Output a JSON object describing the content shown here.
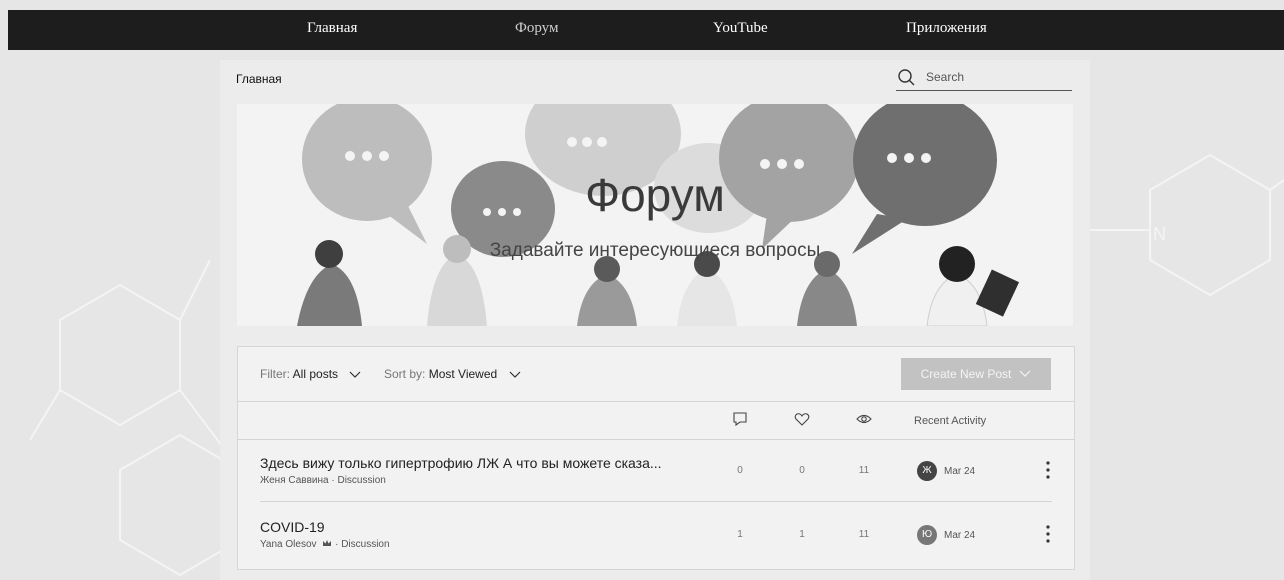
{
  "nav": {
    "items": [
      "Главная",
      "Форум",
      "YouTube",
      "Приложения"
    ]
  },
  "breadcrumb": "Главная",
  "search": {
    "placeholder": "Search"
  },
  "hero": {
    "title": "Форум",
    "subtitle": "Задавайте интересующиеся вопросы"
  },
  "toolbar": {
    "filter_label": "Filter:",
    "filter_value": "All posts",
    "sort_label": "Sort by:",
    "sort_value": "Most Viewed",
    "create_button": "Create New Post"
  },
  "columns": {
    "comments_icon": "comment-icon",
    "likes_icon": "heart-icon",
    "views_icon": "eye-icon",
    "recent_activity": "Recent Activity"
  },
  "posts": [
    {
      "title": "Здесь вижу только гипертрофию ЛЖ А что вы можете сказа...",
      "author": "Женя Саввина",
      "category": "Discussion",
      "comments": "0",
      "likes": "0",
      "views": "11",
      "avatar": "Ж",
      "date": "Mar 24"
    },
    {
      "title": "COVID-19",
      "author": "Yana Olesov",
      "category": "Discussion",
      "comments": "1",
      "likes": "1",
      "views": "11",
      "avatar": "Ю",
      "date": "Mar 24"
    }
  ],
  "colors": {
    "nav_bg": "#1d1d1d",
    "page_bg": "#ececec",
    "button_bg": "#c2c2c2"
  }
}
